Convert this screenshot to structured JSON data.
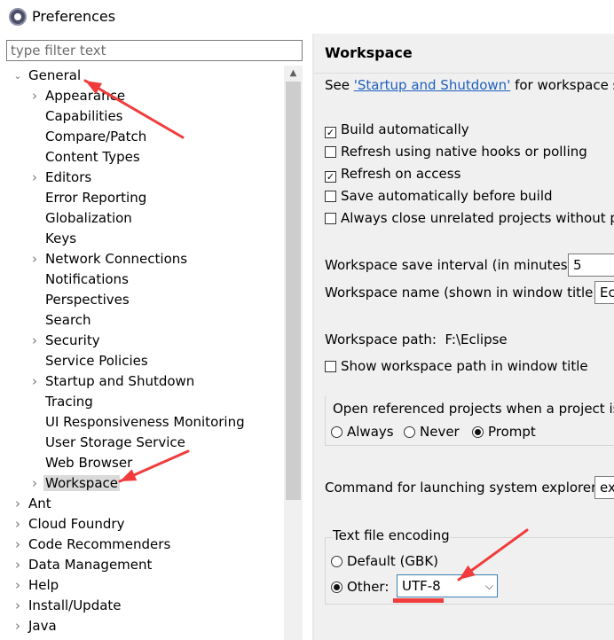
{
  "window": {
    "title": "Preferences"
  },
  "filter": {
    "placeholder": "type filter text",
    "value": ""
  },
  "tree": [
    {
      "label": "General",
      "level": 0,
      "expander": "open"
    },
    {
      "label": "Appearance",
      "level": 1,
      "expander": "closed"
    },
    {
      "label": "Capabilities",
      "level": 1,
      "expander": "none"
    },
    {
      "label": "Compare/Patch",
      "level": 1,
      "expander": "none"
    },
    {
      "label": "Content Types",
      "level": 1,
      "expander": "none"
    },
    {
      "label": "Editors",
      "level": 1,
      "expander": "closed"
    },
    {
      "label": "Error Reporting",
      "level": 1,
      "expander": "none"
    },
    {
      "label": "Globalization",
      "level": 1,
      "expander": "none"
    },
    {
      "label": "Keys",
      "level": 1,
      "expander": "none"
    },
    {
      "label": "Network Connections",
      "level": 1,
      "expander": "closed"
    },
    {
      "label": "Notifications",
      "level": 1,
      "expander": "none"
    },
    {
      "label": "Perspectives",
      "level": 1,
      "expander": "none"
    },
    {
      "label": "Search",
      "level": 1,
      "expander": "none"
    },
    {
      "label": "Security",
      "level": 1,
      "expander": "closed"
    },
    {
      "label": "Service Policies",
      "level": 1,
      "expander": "none"
    },
    {
      "label": "Startup and Shutdown",
      "level": 1,
      "expander": "closed"
    },
    {
      "label": "Tracing",
      "level": 1,
      "expander": "none"
    },
    {
      "label": "UI Responsiveness Monitoring",
      "level": 1,
      "expander": "none"
    },
    {
      "label": "User Storage Service",
      "level": 1,
      "expander": "none"
    },
    {
      "label": "Web Browser",
      "level": 1,
      "expander": "none"
    },
    {
      "label": "Workspace",
      "level": 1,
      "expander": "closed",
      "selected": true
    },
    {
      "label": "Ant",
      "level": 0,
      "expander": "closed"
    },
    {
      "label": "Cloud Foundry",
      "level": 0,
      "expander": "closed"
    },
    {
      "label": "Code Recommenders",
      "level": 0,
      "expander": "closed"
    },
    {
      "label": "Data Management",
      "level": 0,
      "expander": "closed"
    },
    {
      "label": "Help",
      "level": 0,
      "expander": "closed"
    },
    {
      "label": "Install/Update",
      "level": 0,
      "expander": "closed"
    },
    {
      "label": "Java",
      "level": 0,
      "expander": "closed"
    }
  ],
  "page": {
    "title": "Workspace",
    "desc_prefix": "See ",
    "desc_link": "'Startup and Shutdown'",
    "desc_suffix": " for workspace st",
    "checkboxes": [
      {
        "label": "Build automatically",
        "checked": true
      },
      {
        "label": "Refresh using native hooks or polling",
        "checked": false
      },
      {
        "label": "Refresh on access",
        "checked": true
      },
      {
        "label": "Save automatically before build",
        "checked": false
      },
      {
        "label": "Always close unrelated projects without pr",
        "checked": false
      }
    ],
    "save_interval_label": "Workspace save interval (in minutes):",
    "save_interval_value": "5",
    "workspace_name_label": "Workspace name (shown in window title):",
    "workspace_name_value": "Ec",
    "workspace_path_label": "Workspace path:",
    "workspace_path_value": "F:\\Eclipse",
    "show_path_label": "Show workspace path in window title",
    "show_path_checked": false,
    "open_projects_title": "Open referenced projects when a project is",
    "open_projects_options": [
      {
        "label": "Always",
        "selected": false
      },
      {
        "label": "Never",
        "selected": false
      },
      {
        "label": "Prompt",
        "selected": true
      }
    ],
    "explorer_label": "Command for launching system explorer:",
    "explorer_value": "ex",
    "encoding_title": "Text file encoding",
    "encoding_default_label": "Default (GBK)",
    "encoding_default_selected": false,
    "encoding_other_label": "Other:",
    "encoding_other_selected": true,
    "encoding_value": "UTF-8"
  },
  "colors": {
    "annotation": "#f03c3c",
    "link": "#1f5fbf",
    "selection": "#dadada"
  }
}
